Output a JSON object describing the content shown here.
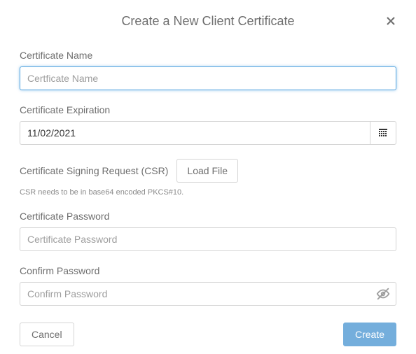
{
  "dialog": {
    "title": "Create a New Client Certificate"
  },
  "fields": {
    "name": {
      "label": "Certificate Name",
      "placeholder": "Certficate Name",
      "value": ""
    },
    "expiration": {
      "label": "Certificate Expiration",
      "value": "11/02/2021"
    },
    "csr": {
      "label": "Certificate Signing Request (CSR)",
      "button": "Load File",
      "hint": "CSR needs to be in base64 encoded PKCS#10."
    },
    "password": {
      "label": "Certificate Password",
      "placeholder": "Certificate Password",
      "value": ""
    },
    "confirm": {
      "label": "Confirm Password",
      "placeholder": "Confirm Password",
      "value": ""
    }
  },
  "buttons": {
    "cancel": "Cancel",
    "create": "Create"
  }
}
